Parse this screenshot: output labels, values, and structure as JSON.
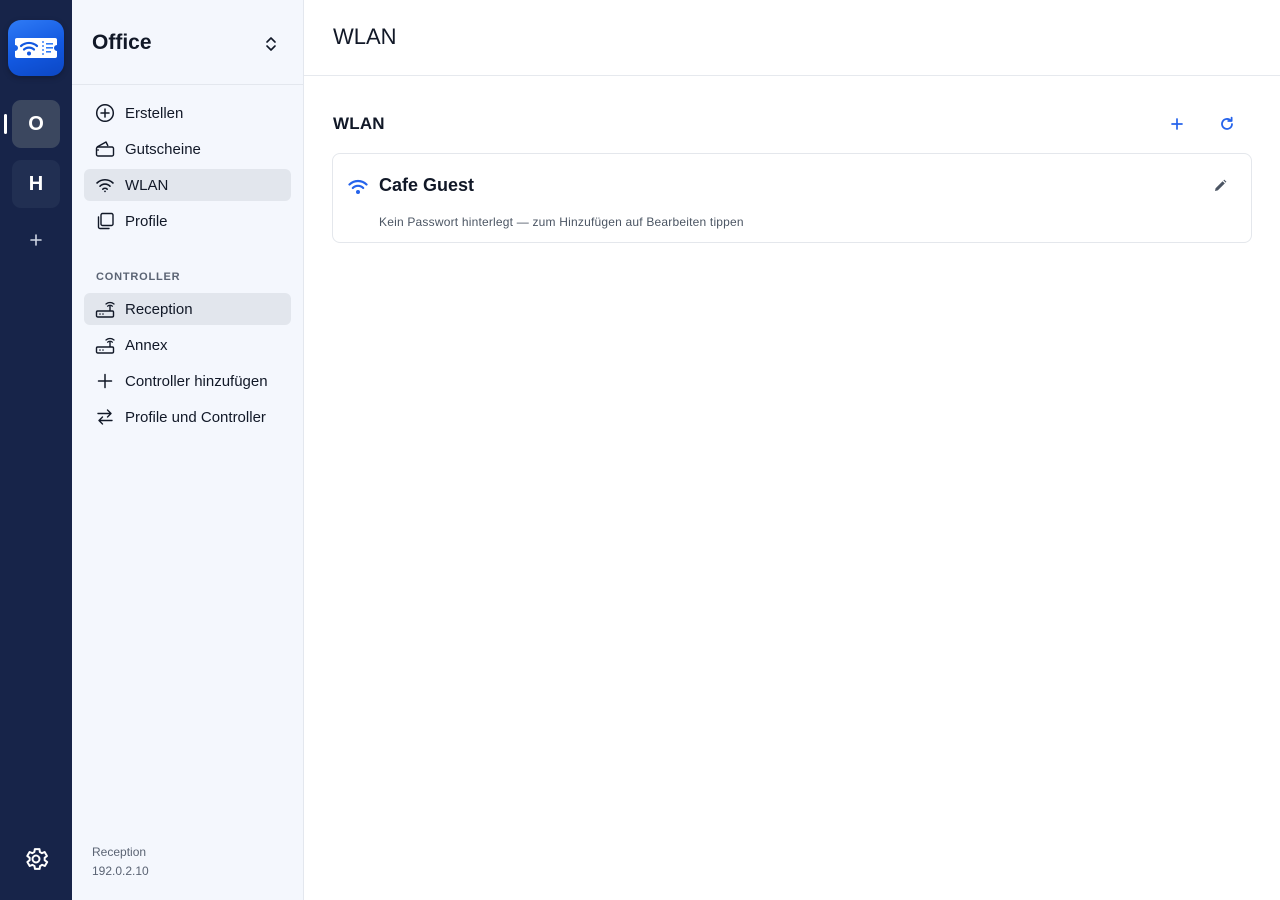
{
  "rail": {
    "workspaces": [
      {
        "letter": "O",
        "active": true
      },
      {
        "letter": "H",
        "active": false
      }
    ]
  },
  "sidebar": {
    "workspace_name": "Office",
    "nav_items": [
      {
        "label": "Erstellen",
        "icon": "plus-circle-icon"
      },
      {
        "label": "Gutscheine",
        "icon": "ticket-icon"
      },
      {
        "label": "WLAN",
        "icon": "wifi-icon",
        "selected": true
      },
      {
        "label": "Profile",
        "icon": "profiles-stack-icon"
      }
    ],
    "controller_section_label": "CONTROLLER",
    "controller_items": [
      {
        "label": "Reception",
        "icon": "router-icon",
        "selected": true
      },
      {
        "label": "Annex",
        "icon": "router-icon"
      },
      {
        "label": "Controller hinzufügen",
        "icon": "plus-icon"
      },
      {
        "label": "Profile und Controller",
        "icon": "swap-arrows-icon"
      }
    ],
    "footer": {
      "controller_name": "Reception",
      "controller_ip": "192.0.2.10"
    }
  },
  "main": {
    "page_title": "WLAN",
    "section_title": "WLAN",
    "wlans": [
      {
        "name": "Cafe Guest",
        "hint": "Kein Passwort hinterlegt — zum Hinzufügen auf Bearbeiten tippen"
      }
    ]
  },
  "colors": {
    "rail_bg": "#172449",
    "sidebar_bg": "#f4f7fd",
    "accent": "#2563eb",
    "selected_item_bg": "#e2e6ed"
  }
}
